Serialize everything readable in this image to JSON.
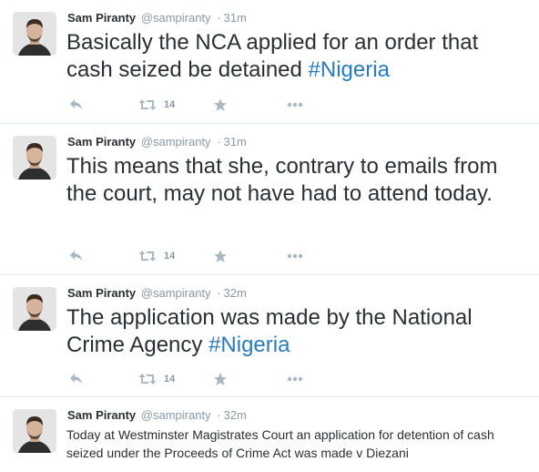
{
  "tweets": [
    {
      "fullname": "Sam Piranty",
      "username": "@sampiranty",
      "separator": "·",
      "time": "31m",
      "text": "Basically the NCA applied for an order that cash seized be detained ",
      "hashtag": "#Nigeria",
      "retweet_count": "14"
    },
    {
      "fullname": "Sam Piranty",
      "username": "@sampiranty",
      "separator": "·",
      "time": "31m",
      "text": "This means that she, contrary to emails from the court, may not have had to attend today.",
      "hashtag": "",
      "retweet_count": "14"
    },
    {
      "fullname": "Sam Piranty",
      "username": "@sampiranty",
      "separator": "·",
      "time": "32m",
      "text": "The application was made by the National Crime Agency ",
      "hashtag": "#Nigeria",
      "retweet_count": "14"
    },
    {
      "fullname": "Sam Piranty",
      "username": "@sampiranty",
      "separator": "·",
      "time": "32m",
      "text": "Today at Westminster Magistrates Court an application for detention of cash seized under the Proceeds of Crime Act was made v Diezani",
      "hashtag": "",
      "retweet_count": ""
    }
  ],
  "icons": {
    "reply": "reply-icon",
    "retweet": "retweet-icon",
    "favorite": "star-icon",
    "more": "more-icon"
  },
  "colors": {
    "hashtag": "#2b7bb9",
    "meta": "#8899a6",
    "icon": "#aab8c2"
  }
}
